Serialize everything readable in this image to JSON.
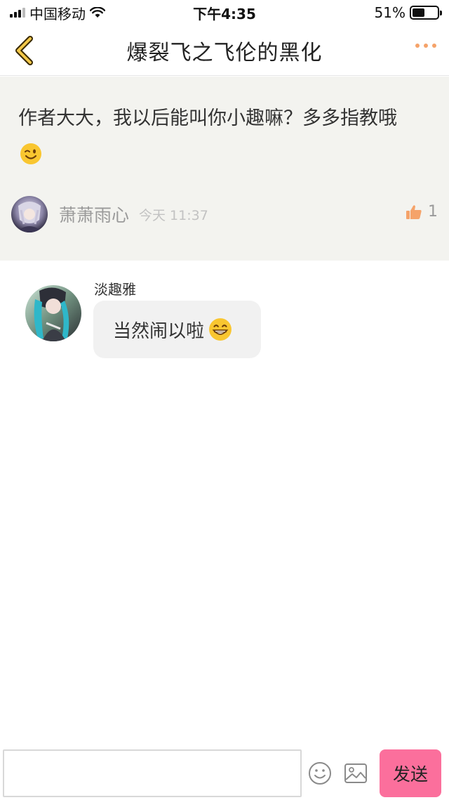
{
  "status_bar": {
    "carrier": "中国移动",
    "time": "下午4:35",
    "battery_text": "51%",
    "battery_level": 0.51
  },
  "nav": {
    "title": "爆裂飞之飞伦的黑化",
    "back_icon": "chevron-left-icon",
    "more_icon": "more-dots-icon",
    "accent_color": "#f5a36a"
  },
  "comment": {
    "text": "作者大大，我以后能叫你小趣嘛？多多指教哦",
    "emoji": "wink-emoji",
    "author": "萧萧雨心",
    "time": "今天 11:37",
    "like_count": "1",
    "like_icon": "thumbs-up-icon",
    "background": "#f3f3ef"
  },
  "reply": {
    "author": "淡趣雅",
    "text": "当然闹以啦",
    "emoji": "grin-emoji"
  },
  "input_bar": {
    "placeholder": "",
    "emoji_icon": "smiley-icon",
    "image_icon": "image-icon",
    "send_label": "发送",
    "send_color": "#fb6f9c"
  }
}
